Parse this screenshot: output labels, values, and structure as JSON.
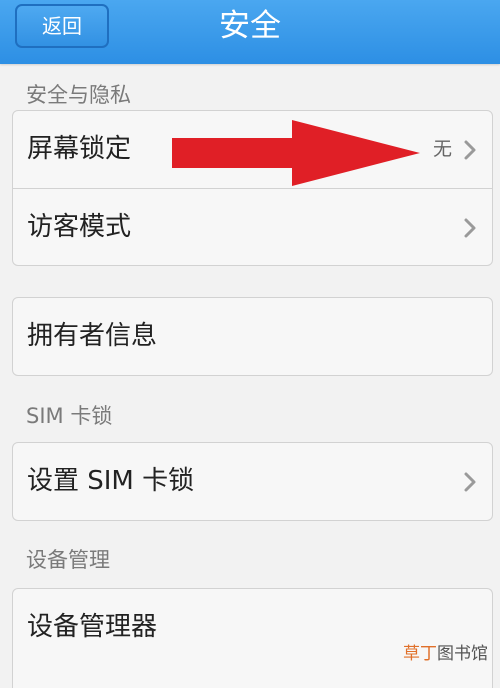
{
  "header": {
    "back_label": "返回",
    "title": "安全"
  },
  "sections": [
    {
      "label": "安全与隐私",
      "rows": [
        {
          "label": "屏幕锁定",
          "value": "无"
        },
        {
          "label": "访客模式"
        }
      ]
    },
    {
      "rows": [
        {
          "label": "拥有者信息"
        }
      ]
    },
    {
      "label": "SIM 卡锁",
      "rows": [
        {
          "label": "设置 SIM 卡锁"
        }
      ]
    },
    {
      "label": "设备管理",
      "rows": [
        {
          "label": "设备管理器"
        }
      ]
    }
  ],
  "watermark": {
    "part1": "草丁",
    "part2": "图书馆"
  },
  "colors": {
    "header": "#3a9ae8",
    "arrow": "#e01f26",
    "watermark_orange": "#e0702a"
  },
  "icons": {
    "row_chevron": "chevron-right-icon",
    "annotation": "red-arrow-annotation"
  }
}
